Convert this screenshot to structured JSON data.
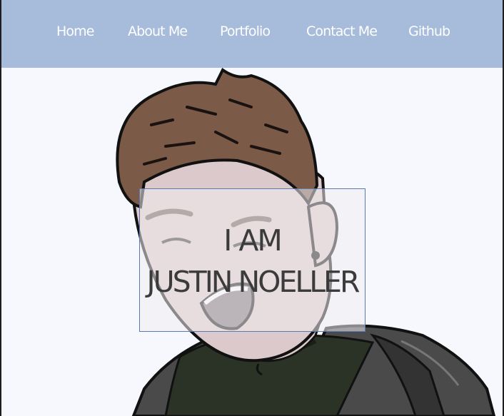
{
  "nav": {
    "items": [
      {
        "label": "Home"
      },
      {
        "label": "About Me"
      },
      {
        "label": "Portfolio"
      },
      {
        "label": "Contact Me"
      },
      {
        "label": "Github"
      }
    ]
  },
  "hero": {
    "line1": "I AM",
    "line2": "JUSTIN NOELLER"
  },
  "colors": {
    "navbar": "#a7bbdb",
    "page_background": "#f6f8fd",
    "hero_text": "#3b3b3b",
    "overlay_border": "#5a79b0"
  }
}
